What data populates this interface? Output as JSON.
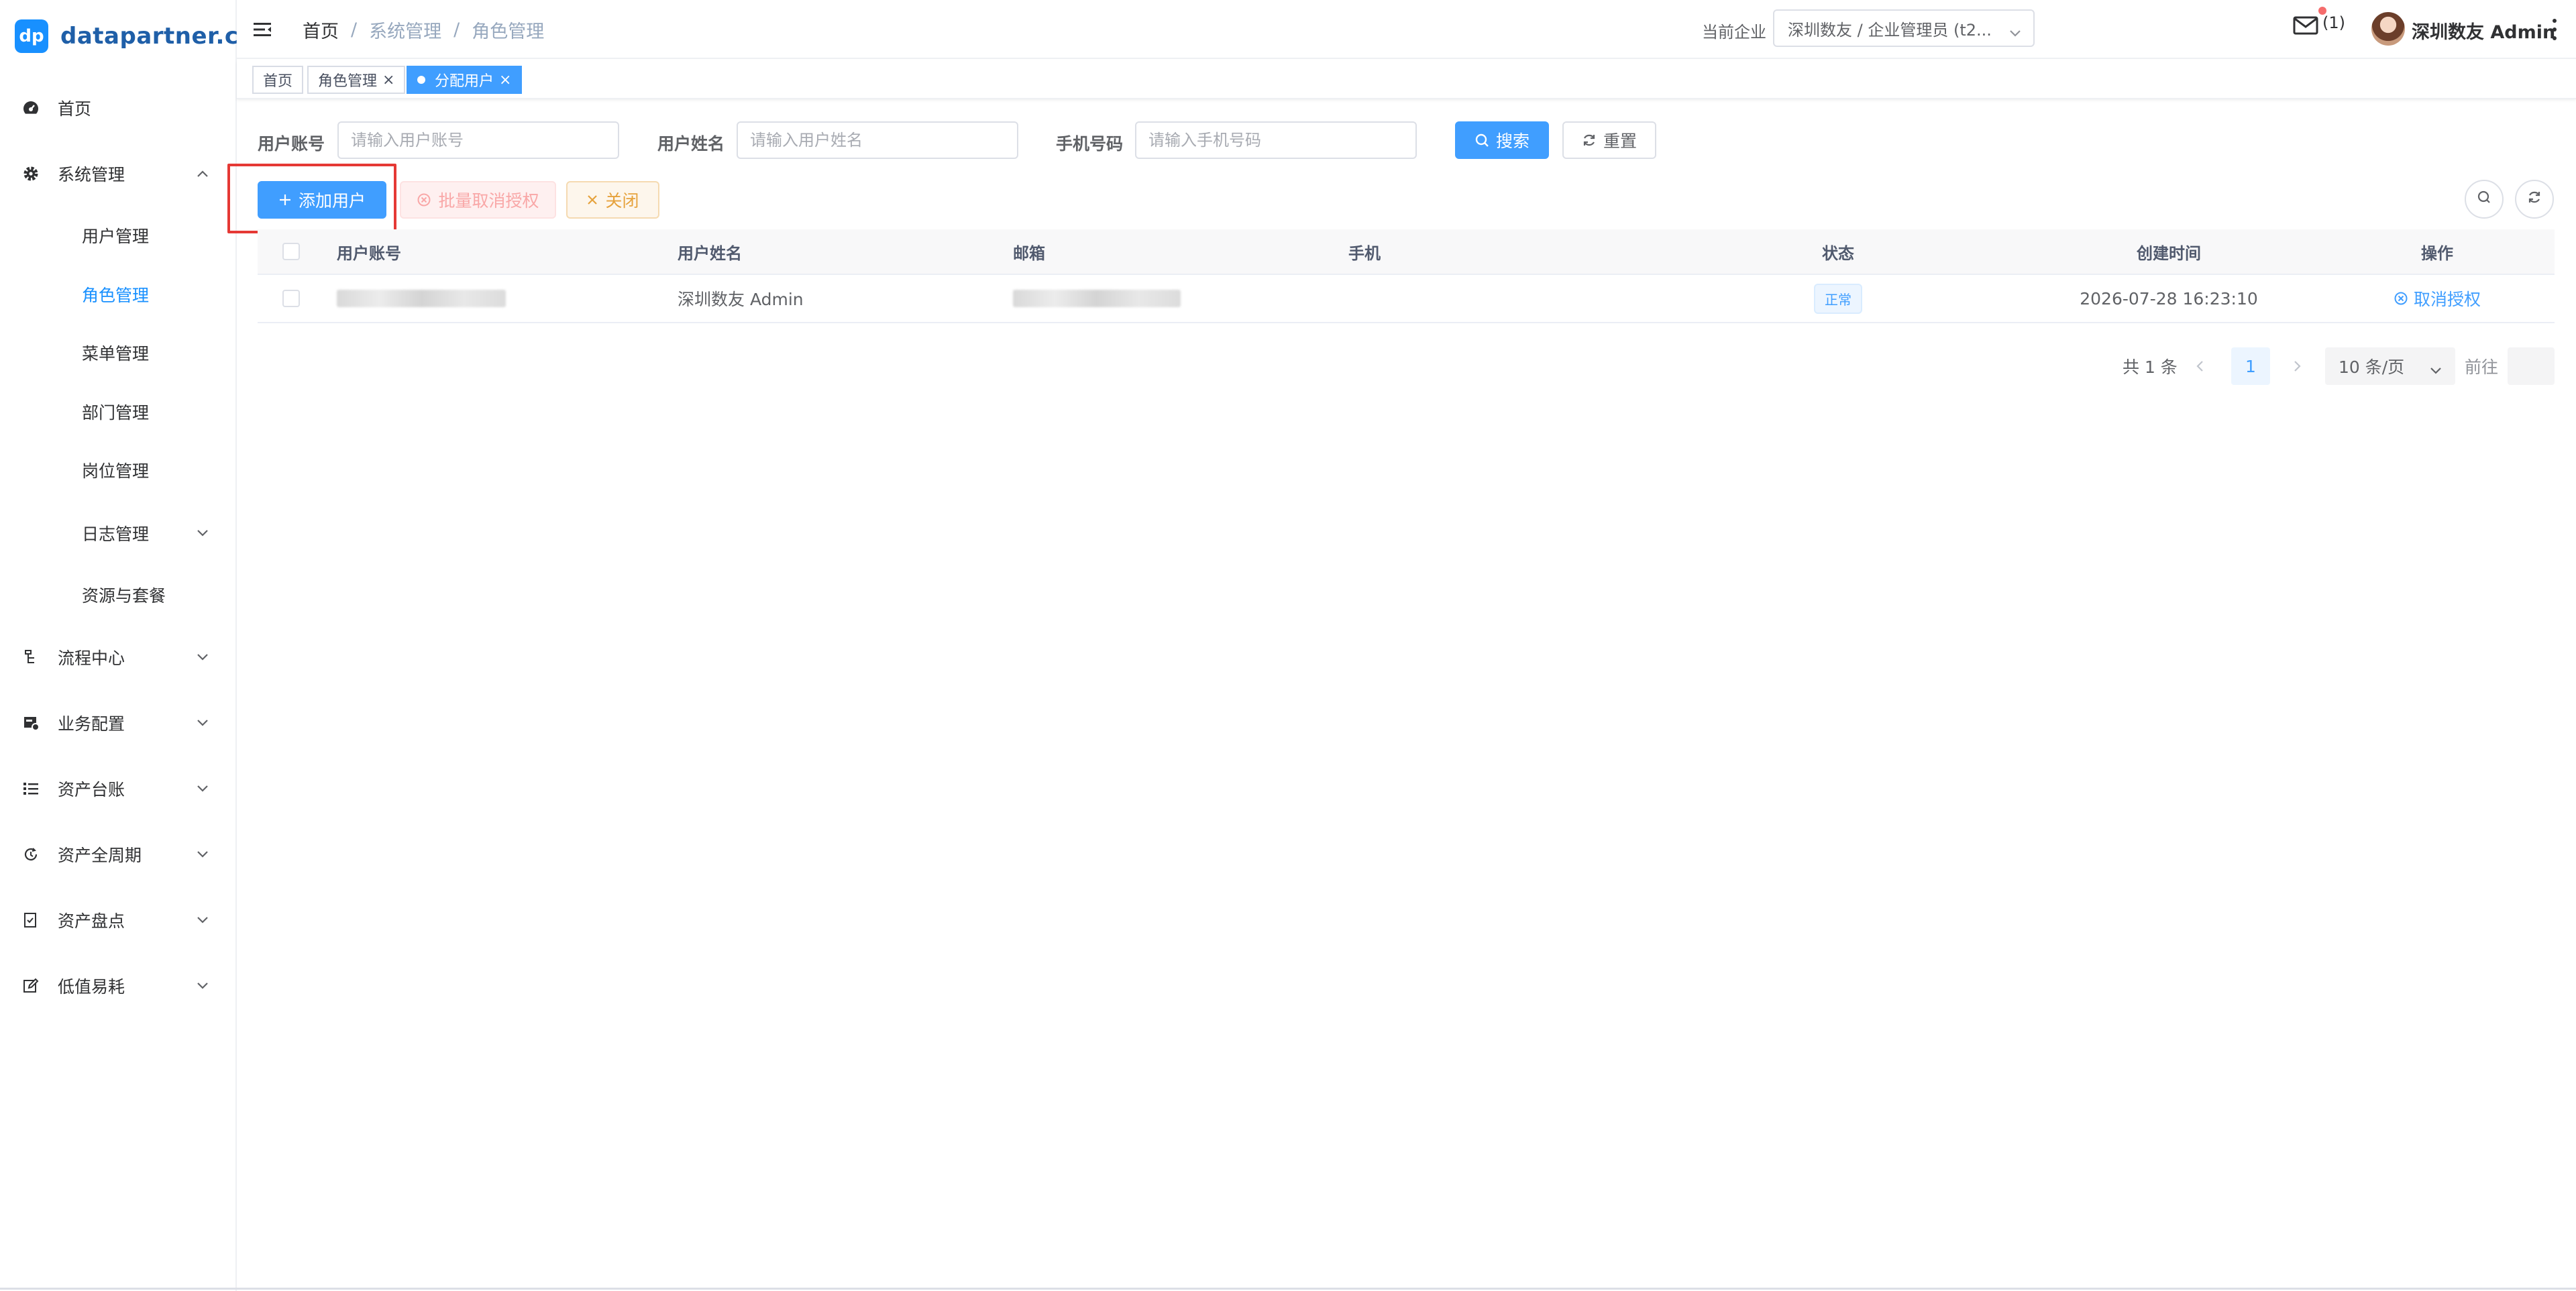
{
  "brand": {
    "badge": "dp",
    "name": "datapartner.cn"
  },
  "sidebar": {
    "items": [
      {
        "label": "首页"
      },
      {
        "label": "系统管理"
      },
      {
        "label": "用户管理"
      },
      {
        "label": "角色管理"
      },
      {
        "label": "菜单管理"
      },
      {
        "label": "部门管理"
      },
      {
        "label": "岗位管理"
      },
      {
        "label": "日志管理"
      },
      {
        "label": "资源与套餐"
      },
      {
        "label": "流程中心"
      },
      {
        "label": "业务配置"
      },
      {
        "label": "资产台账"
      },
      {
        "label": "资产全周期"
      },
      {
        "label": "资产盘点"
      },
      {
        "label": "低值易耗"
      }
    ],
    "active_item": "角色管理",
    "active_color": "#1890ff"
  },
  "header": {
    "breadcrumb": [
      "首页",
      "系统管理",
      "角色管理"
    ],
    "breadcrumb_sep": "/",
    "company_label": "当前企业",
    "company_value": "深圳数友 / 企业管理员 (t2...",
    "mail_count": "(1)",
    "user_name": "深圳数友 Admin"
  },
  "tabs": [
    {
      "label": "首页",
      "closable": false
    },
    {
      "label": "角色管理",
      "closable": true
    },
    {
      "label": "分配用户",
      "closable": true,
      "active": true
    }
  ],
  "tab_close_glyph": "×",
  "search": {
    "account_label": "用户账号",
    "account_placeholder": "请输入用户账号",
    "name_label": "用户姓名",
    "name_placeholder": "请输入用户姓名",
    "phone_label": "手机号码",
    "phone_placeholder": "请输入手机号码",
    "search_btn": "搜索",
    "reset_btn": "重置"
  },
  "toolbar": {
    "add_btn": "添加用户",
    "batch_cancel_btn": "批量取消授权",
    "close_btn": "关闭"
  },
  "table": {
    "columns": [
      "用户账号",
      "用户姓名",
      "邮箱",
      "手机",
      "状态",
      "创建时间",
      "操作"
    ],
    "rows": [
      {
        "account": "",
        "name": "深圳数友 Admin",
        "email": "",
        "phone": "",
        "status": "正常",
        "created": "2026-07-28 16:23:10",
        "action": "取消授权"
      }
    ]
  },
  "pagination": {
    "total_text": "共 1 条",
    "current_page": "1",
    "page_size": "10 条/页",
    "goto_label": "前往"
  },
  "colors": {
    "primary": "#409eff",
    "highlight_box": "#e53935",
    "mail_dot": "#f56c6c"
  }
}
